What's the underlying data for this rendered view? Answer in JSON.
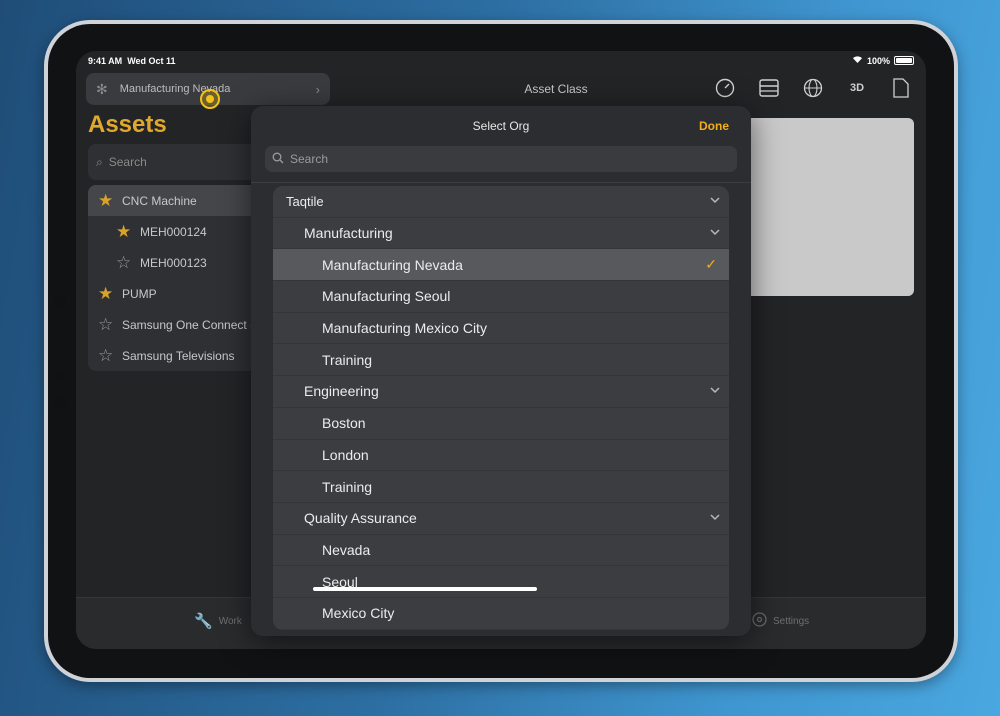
{
  "status": {
    "time": "9:41 AM",
    "date": "Wed Oct 11",
    "battery": "100%",
    "battery_level": 1.0
  },
  "header": {
    "org_selector_label": "Manufacturing Nevada",
    "nav_title": "Asset Class",
    "icons": [
      "gauge-icon",
      "panel-icon",
      "globe-icon",
      "rotate-3d-icon",
      "document-icon"
    ],
    "icon_3d_text": "3D"
  },
  "sidebar": {
    "title": "Assets",
    "search_placeholder": "Search",
    "items": [
      {
        "label": "CNC Machine",
        "starred": true,
        "indent": 0,
        "selected": true
      },
      {
        "label": "MEH000124",
        "starred": true,
        "indent": 1,
        "selected": false
      },
      {
        "label": "MEH000123",
        "starred": false,
        "indent": 1,
        "selected": false
      },
      {
        "label": "PUMP",
        "starred": true,
        "indent": 0,
        "selected": false
      },
      {
        "label": "Samsung One Connect (",
        "starred": false,
        "indent": 0,
        "selected": false
      },
      {
        "label": "Samsung Televisions",
        "starred": false,
        "indent": 0,
        "selected": false
      }
    ]
  },
  "tabbar": {
    "work_label": "Work",
    "settings_label": "Settings"
  },
  "modal": {
    "title": "Select Org",
    "done_label": "Done",
    "search_placeholder": "Search",
    "rows": [
      {
        "label": "Taqtile",
        "level": 0,
        "expandable": true
      },
      {
        "label": "Manufacturing",
        "level": 1,
        "expandable": true
      },
      {
        "label": "Manufacturing Nevada",
        "level": 2,
        "selected": true
      },
      {
        "label": "Manufacturing Seoul",
        "level": 2
      },
      {
        "label": "Manufacturing Mexico City",
        "level": 2
      },
      {
        "label": "Training",
        "level": 2
      },
      {
        "label": "Engineering",
        "level": 1,
        "expandable": true
      },
      {
        "label": "Boston",
        "level": 2
      },
      {
        "label": "London",
        "level": 2
      },
      {
        "label": "Training",
        "level": 2
      },
      {
        "label": "Quality Assurance",
        "level": 1,
        "expandable": true
      },
      {
        "label": "Nevada",
        "level": 2
      },
      {
        "label": "Seoul",
        "level": 2
      },
      {
        "label": "Mexico City",
        "level": 2
      }
    ]
  },
  "colors": {
    "accent": "#f1ae1d",
    "star": "#d9a32a",
    "background": "#232426"
  }
}
